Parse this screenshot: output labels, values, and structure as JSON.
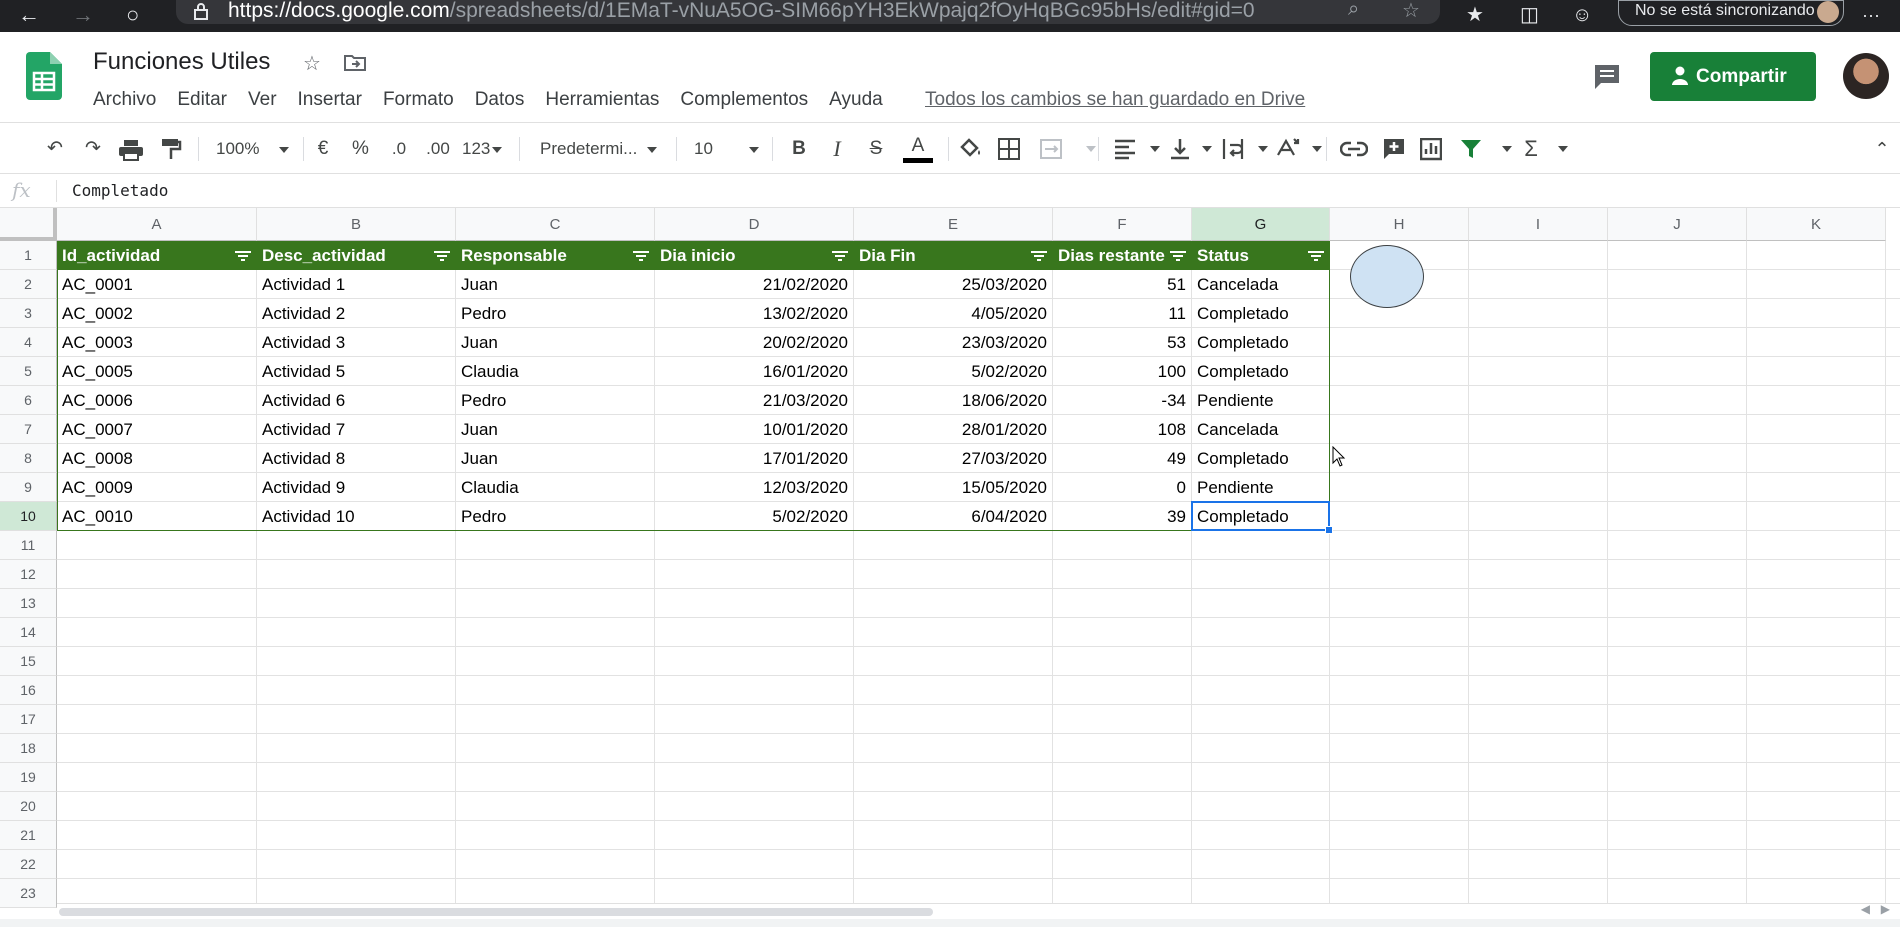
{
  "browser": {
    "url_host": "https://docs.google.com",
    "url_rest": "/spreadsheets/d/1EMaT-vNuA5OG-SIM66pYH3EkWpajq2fOyHqBGc95bHs/edit#gid=0",
    "sync_status": "No se está sincronizando",
    "more_label": "···"
  },
  "doc": {
    "title": "Funciones Utiles",
    "saved_status": "Todos los cambios se han guardado en Drive",
    "share_label": "Compartir"
  },
  "menu": [
    "Archivo",
    "Editar",
    "Ver",
    "Insertar",
    "Formato",
    "Datos",
    "Herramientas",
    "Complementos",
    "Ayuda"
  ],
  "toolbar": {
    "zoom": "100%",
    "currency": "€",
    "percent": "%",
    "decrease_decimals": ".0",
    "increase_decimals": ".00",
    "more_formats": "123",
    "font": "Predetermi...",
    "font_size": "10",
    "bold": "B",
    "italic": "I",
    "strikethrough": "S",
    "text_color": "A",
    "functions": "Σ"
  },
  "formula_bar": {
    "fx_label": "fx",
    "value": "Completado"
  },
  "columns": [
    "A",
    "B",
    "C",
    "D",
    "E",
    "F",
    "G",
    "H",
    "I",
    "J",
    "K"
  ],
  "rows": [
    "1",
    "2",
    "3",
    "4",
    "5",
    "6",
    "7",
    "8",
    "9",
    "10",
    "11",
    "12",
    "13",
    "14",
    "15",
    "16",
    "17",
    "18",
    "19",
    "20",
    "21",
    "22",
    "23"
  ],
  "table": {
    "headers": [
      "Id_actividad",
      "Desc_actividad",
      "Responsable",
      "Dia inicio",
      "Dia Fin",
      "Dias restante",
      "Status"
    ],
    "rows": [
      [
        "AC_0001",
        "Actividad 1",
        "Juan",
        "21/02/2020",
        "25/03/2020",
        "51",
        "Cancelada"
      ],
      [
        "AC_0002",
        "Actividad 2",
        "Pedro",
        "13/02/2020",
        "4/05/2020",
        "11",
        "Completado"
      ],
      [
        "AC_0003",
        "Actividad 3",
        "Juan",
        "20/02/2020",
        "23/03/2020",
        "53",
        "Completado"
      ],
      [
        "AC_0005",
        "Actividad 5",
        "Claudia",
        "16/01/2020",
        "5/02/2020",
        "100",
        "Completado"
      ],
      [
        "AC_0006",
        "Actividad 6",
        "Pedro",
        "21/03/2020",
        "18/06/2020",
        "-34",
        "Pendiente"
      ],
      [
        "AC_0007",
        "Actividad 7",
        "Juan",
        "10/01/2020",
        "28/01/2020",
        "108",
        "Cancelada"
      ],
      [
        "AC_0008",
        "Actividad 8",
        "Juan",
        "17/01/2020",
        "27/03/2020",
        "49",
        "Completado"
      ],
      [
        "AC_0009",
        "Actividad 9",
        "Claudia",
        "12/03/2020",
        "15/05/2020",
        "0",
        "Pendiente"
      ],
      [
        "AC_0010",
        "Actividad 10",
        "Pedro",
        "5/02/2020",
        "6/04/2020",
        "39",
        "Completado"
      ]
    ]
  },
  "colors": {
    "header_fill": "#38761d",
    "share_button": "#188038",
    "active_cell": "#1a73e8",
    "shape_fill": "#cfe2f3"
  }
}
